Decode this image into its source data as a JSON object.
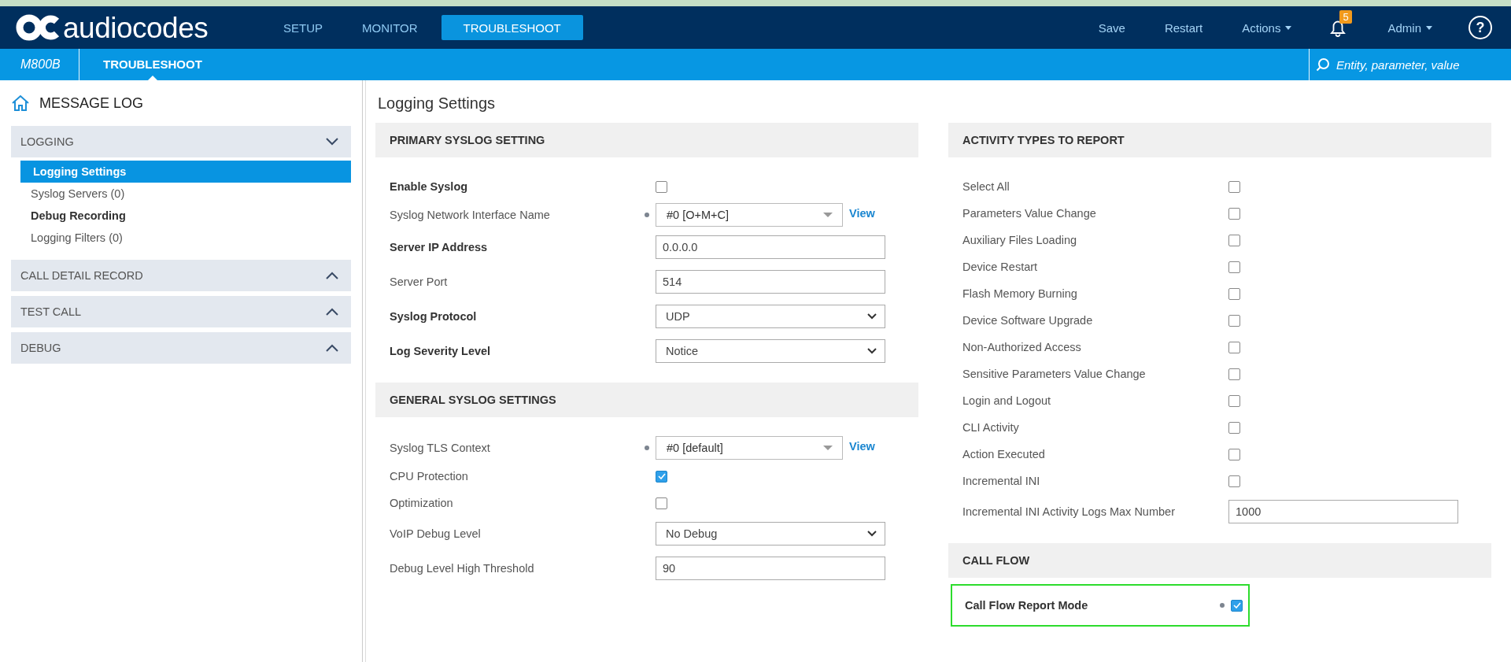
{
  "top_nav": {
    "logo": "audiocodes",
    "tabs": [
      {
        "label": "SETUP",
        "selected": false
      },
      {
        "label": "MONITOR",
        "selected": false
      },
      {
        "label": "TROUBLESHOOT",
        "selected": true
      }
    ],
    "actions": [
      {
        "kind": "link",
        "label": "Save"
      },
      {
        "kind": "link",
        "label": "Restart"
      },
      {
        "kind": "menu",
        "label": "Actions"
      },
      {
        "kind": "bell",
        "badge": "5"
      },
      {
        "kind": "menu",
        "label": "Admin"
      },
      {
        "kind": "help",
        "label": "?"
      }
    ]
  },
  "sub_bar": {
    "device": "M800B",
    "section": "TROUBLESHOOT",
    "search": {
      "placeholder": "Entity, parameter, value"
    }
  },
  "sidebar": {
    "title": "MESSAGE LOG",
    "groups": [
      {
        "label": "LOGGING",
        "expanded": true,
        "items": [
          {
            "label": "Logging Settings",
            "kind": "link",
            "selected": true
          },
          {
            "label": "Syslog Servers (0)",
            "kind": "link",
            "selected": false
          },
          {
            "label": "Debug Recording",
            "kind": "group",
            "selected": false
          },
          {
            "label": "Logging Filters (0)",
            "kind": "link",
            "selected": false
          }
        ]
      },
      {
        "label": "CALL DETAIL RECORD",
        "expanded": false
      },
      {
        "label": "TEST CALL",
        "expanded": false
      },
      {
        "label": "DEBUG",
        "expanded": false
      }
    ]
  },
  "page_title": "Logging Settings",
  "columns": [
    {
      "panels": [
        {
          "title": "PRIMARY SYSLOG SETTING",
          "rows": [
            {
              "label": "Enable Syslog",
              "bold": true,
              "dot": false,
              "kind": "checkbox",
              "checked": false
            },
            {
              "label": "Syslog Network Interface Name",
              "bold": false,
              "dot": true,
              "kind": "combo",
              "value": "#0 [O+M+C]",
              "link": "View"
            },
            {
              "label": "Server IP Address",
              "bold": true,
              "dot": false,
              "kind": "text",
              "value": "0.0.0.0"
            },
            {
              "label": "Server Port",
              "bold": false,
              "dot": false,
              "kind": "text",
              "value": "514"
            },
            {
              "label": "Syslog Protocol",
              "bold": true,
              "dot": false,
              "kind": "select",
              "value": "UDP"
            },
            {
              "label": "Log Severity Level",
              "bold": true,
              "dot": false,
              "kind": "select",
              "value": "Notice"
            }
          ]
        },
        {
          "title": "GENERAL SYSLOG SETTINGS",
          "rows": [
            {
              "label": "Syslog TLS Context",
              "bold": false,
              "dot": true,
              "kind": "combo",
              "value": "#0 [default]",
              "link": "View"
            },
            {
              "label": "CPU Protection",
              "bold": false,
              "dot": false,
              "kind": "checkbox",
              "checked": true
            },
            {
              "label": "Optimization",
              "bold": false,
              "dot": false,
              "kind": "checkbox",
              "checked": false
            },
            {
              "label": "VoIP Debug Level",
              "bold": false,
              "dot": false,
              "kind": "select",
              "value": "No Debug"
            },
            {
              "label": "Debug Level High Threshold",
              "bold": false,
              "dot": false,
              "kind": "text",
              "value": "90"
            }
          ]
        }
      ]
    },
    {
      "panels": [
        {
          "title": "ACTIVITY TYPES TO REPORT",
          "rows": [
            {
              "label": "Select All",
              "bold": false,
              "dot": false,
              "kind": "checkbox",
              "checked": false
            },
            {
              "label": "Parameters Value Change",
              "bold": false,
              "dot": false,
              "kind": "checkbox",
              "checked": false
            },
            {
              "label": "Auxiliary Files Loading",
              "bold": false,
              "dot": false,
              "kind": "checkbox",
              "checked": false
            },
            {
              "label": "Device Restart",
              "bold": false,
              "dot": false,
              "kind": "checkbox",
              "checked": false
            },
            {
              "label": "Flash Memory Burning",
              "bold": false,
              "dot": false,
              "kind": "checkbox",
              "checked": false
            },
            {
              "label": "Device Software Upgrade",
              "bold": false,
              "dot": false,
              "kind": "checkbox",
              "checked": false
            },
            {
              "label": "Non-Authorized Access",
              "bold": false,
              "dot": false,
              "kind": "checkbox",
              "checked": false
            },
            {
              "label": "Sensitive Parameters Value Change",
              "bold": false,
              "dot": false,
              "kind": "checkbox",
              "checked": false
            },
            {
              "label": "Login and Logout",
              "bold": false,
              "dot": false,
              "kind": "checkbox",
              "checked": false
            },
            {
              "label": "CLI Activity",
              "bold": false,
              "dot": false,
              "kind": "checkbox",
              "checked": false
            },
            {
              "label": "Action Executed",
              "bold": false,
              "dot": false,
              "kind": "checkbox",
              "checked": false
            },
            {
              "label": "Incremental INI",
              "bold": false,
              "dot": false,
              "kind": "checkbox",
              "checked": false
            },
            {
              "label": "Incremental INI Activity Logs Max Number",
              "bold": false,
              "dot": false,
              "kind": "text",
              "value": "1000"
            }
          ]
        },
        {
          "title": "CALL FLOW",
          "rows": [
            {
              "label": "Call Flow Report Mode",
              "bold": true,
              "dot": true,
              "highlighted": true,
              "kind": "checkbox",
              "checked": true
            }
          ]
        }
      ]
    }
  ]
}
